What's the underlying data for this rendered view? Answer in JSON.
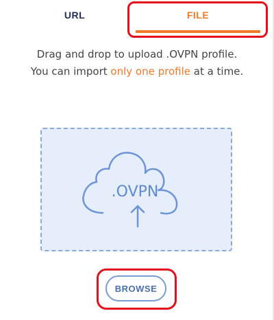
{
  "tabs": {
    "url_label": "URL",
    "file_label": "FILE",
    "active": "FILE"
  },
  "description": {
    "line1": "Drag and drop to upload .OVPN profile.",
    "line2_before": "You can import ",
    "line2_highlight": "only one profile",
    "line2_after": " at a time."
  },
  "dropzone": {
    "icon": "cloud-upload-icon",
    "label": ".OVPN"
  },
  "browse": {
    "label": "BROWSE"
  },
  "colors": {
    "accent": "#f07a28",
    "highlight_box": "#e3101c",
    "dropzone_bg": "#e7eefb",
    "icon_blue": "#5e8ad2",
    "tab_inactive": "#1e2e5a"
  }
}
